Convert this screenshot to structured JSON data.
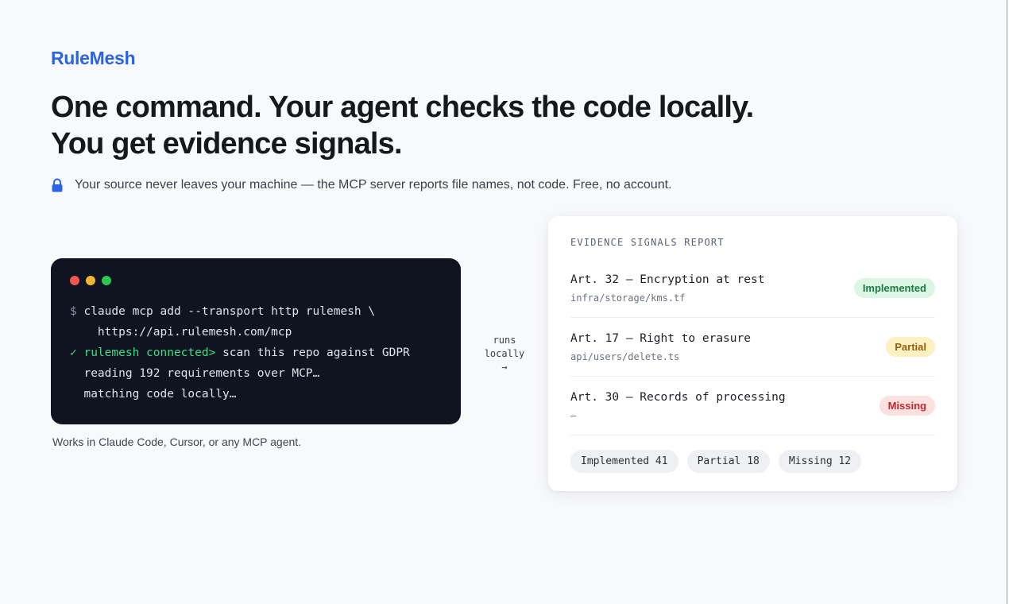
{
  "brand": {
    "name": "RuleMesh",
    "color": "#2b63e6"
  },
  "hero": {
    "headline_line1": "One command. Your agent checks the code locally.",
    "headline_line2": "You get evidence signals.",
    "subline": "Your source never leaves your machine — the MCP server reports file names, not code. Free, no account.",
    "subline_icon": "lock-icon"
  },
  "terminal": {
    "line1_prompt": "$",
    "line1_cmd": " claude mcp add --transport http rulemesh \\",
    "line2": "    https://api.rulemesh.com/mcp",
    "line3_check": "✓",
    "line3_conn": " rulemesh connected>",
    "line3_cmd": " scan this repo against GDPR",
    "line4": "  reading 192 requirements over MCP…",
    "line5": "  matching code locally…"
  },
  "works_note": "Works in Claude Code, Cursor, or any MCP agent.",
  "runs_note": {
    "line1": "runs",
    "line2": "locally",
    "arrow": "→"
  },
  "report": {
    "title": "EVIDENCE SIGNALS REPORT",
    "items": [
      {
        "name": "Art. 32 — Encryption at rest",
        "file": "infra/storage/kms.tf",
        "status": "Implemented"
      },
      {
        "name": "Art. 17 — Right to erasure",
        "file": "api/users/delete.ts",
        "status": "Partial"
      },
      {
        "name": "Art. 30 — Records of processing",
        "file": "—",
        "status": "Missing"
      }
    ],
    "summary": {
      "implemented": "Implemented 41",
      "partial": "Partial 18",
      "missing": "Missing 12"
    }
  },
  "colors": {
    "implemented": "#1c7a41",
    "partial": "#94600a",
    "missing": "#c42a2a"
  }
}
